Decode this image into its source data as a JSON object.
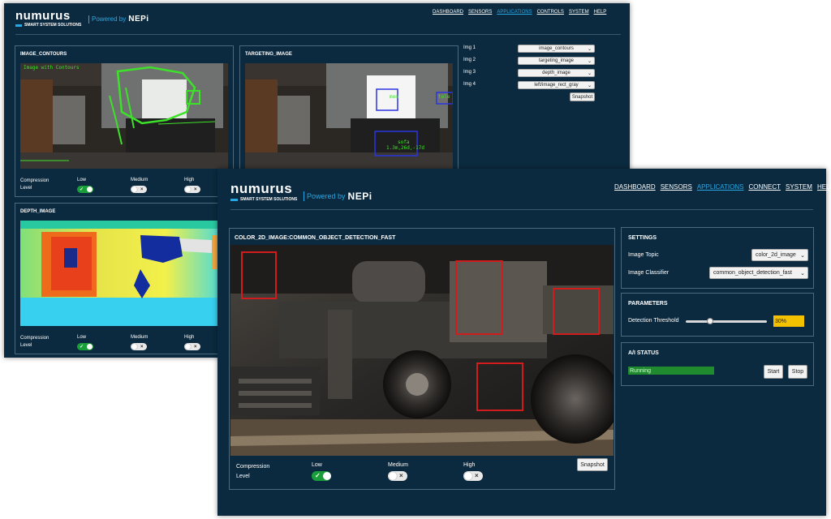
{
  "brand": {
    "name": "numurus",
    "tagline": "SMART SYSTEM SOLUTIONS",
    "powered_by": "Powered by",
    "nepi": "NEPi"
  },
  "back": {
    "nav": [
      {
        "label": "DASHBOARD",
        "active": false
      },
      {
        "label": "SENSORS",
        "active": false
      },
      {
        "label": "APPLICATIONS",
        "active": true
      },
      {
        "label": "CONTROLS",
        "active": false
      },
      {
        "label": "SYSTEM",
        "active": false
      },
      {
        "label": "HELP",
        "active": false
      }
    ],
    "panels": {
      "contours": {
        "title": "IMAGE_CONTOURS",
        "overlay": "Image with Contours"
      },
      "targeting": {
        "title": "TARGETING_IMAGE",
        "box1": "mon",
        "box2": "sofa",
        "box2b": "1.3m,26d,-17d",
        "box3": "tele"
      },
      "depth": {
        "title": "DEPTH_IMAGE"
      }
    },
    "compression": {
      "label_line1": "Compression",
      "label_line2": "Level",
      "low": "Low",
      "medium": "Medium",
      "high": "High"
    },
    "image_selectors": [
      {
        "label": "Img 1",
        "value": "image_contours"
      },
      {
        "label": "Img 2",
        "value": "targeting_image"
      },
      {
        "label": "Img 3",
        "value": "depth_image"
      },
      {
        "label": "Img 4",
        "value": "left/image_rect_gray"
      }
    ],
    "snapshot": "Snapshot"
  },
  "front": {
    "nav": [
      {
        "label": "DASHBOARD",
        "active": false
      },
      {
        "label": "SENSORS",
        "active": false
      },
      {
        "label": "APPLICATIONS",
        "active": true
      },
      {
        "label": "CONNECT",
        "active": false
      },
      {
        "label": "SYSTEM",
        "active": false
      },
      {
        "label": "HELP",
        "active": false
      }
    ],
    "image_title": "COLOR_2D_IMAGE:COMMON_OBJECT_DETECTION_FAST",
    "compression": {
      "label_line1": "Compression",
      "label_line2": "Level",
      "low": "Low",
      "medium": "Medium",
      "high": "High"
    },
    "snapshot": "Snapshot",
    "settings": {
      "title": "SETTINGS",
      "image_topic_label": "Image Topic",
      "image_topic_value": "color_2d_image",
      "classifier_label": "Image Classifier",
      "classifier_value": "common_object_detection_fast"
    },
    "parameters": {
      "title": "PARAMETERS",
      "threshold_label": "Detection Threshold",
      "threshold_value": "30%",
      "threshold_level": 0.3
    },
    "ai_status": {
      "title": "A/I STATUS",
      "status": "Running",
      "start": "Start",
      "stop": "Stop"
    }
  },
  "colors": {
    "bg": "#0b2a3f",
    "accent": "#29a7e1",
    "running": "#1f8a2e",
    "threshold": "#f2c200",
    "bbox": "#d01c1c"
  }
}
